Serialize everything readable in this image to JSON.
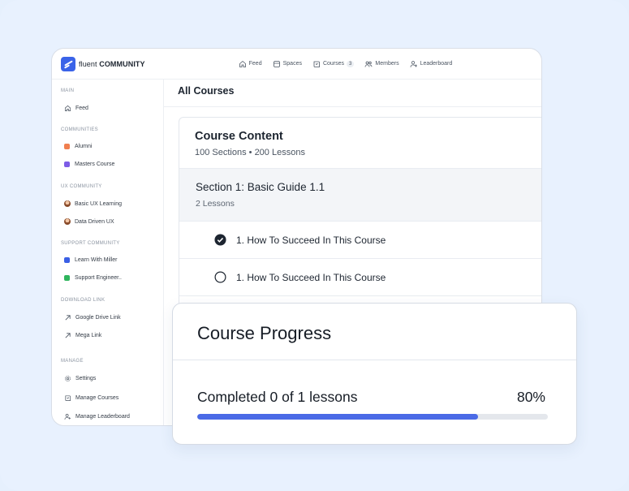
{
  "app": {
    "logo_light": "fluent",
    "logo_bold": "COMMUNITY"
  },
  "topnav": {
    "feed": "Feed",
    "spaces": "Spaces",
    "courses": "Courses",
    "courses_badge": "3",
    "members": "Members",
    "leaderboard": "Leaderboard"
  },
  "sidebar": {
    "main_group": "MAIN",
    "feed": "Feed",
    "communities_group": "COMMUNITIES",
    "alumni": "Alumni",
    "masters_course": "Masters Course",
    "ux_group": "UX COMMUNITY",
    "basic_ux": "Basic UX Learning",
    "data_driven": "Data Driven UX",
    "support_group": "SUPPORT COMMUNITY",
    "learn_miller": "Learn With Miller",
    "support_engineer": "Support Engineer..",
    "download_group": "DOWNLOAD LINK",
    "google_drive": "Google Drive Link",
    "mega_link": "Mega Link",
    "manage_group": "MANAGE",
    "settings": "Settings",
    "manage_courses": "Manage Courses",
    "manage_leaderboard": "Manage Leaderboard"
  },
  "colors": {
    "alumni": "#f07f4f",
    "masters_course": "#7d5ce6",
    "learn_miller": "#3a5fe5",
    "support_engineer": "#2fb55d",
    "progress_fill": "#4a6ae6"
  },
  "main": {
    "title": "All Courses",
    "course_content": {
      "title": "Course Content",
      "meta": "100 Sections •  200 Lessons",
      "section_title": "Section 1: Basic Guide 1.1",
      "section_meta": "2 Lessons",
      "lessons": [
        {
          "title": "1. How To Succeed In This Course",
          "completed": true
        },
        {
          "title": "1. How To Succeed In This Course",
          "completed": false
        }
      ]
    }
  },
  "progress": {
    "title": "Course Progress",
    "label": "Completed 0 of 1 lessons",
    "percent_text": "80%",
    "percent_value": 80
  }
}
